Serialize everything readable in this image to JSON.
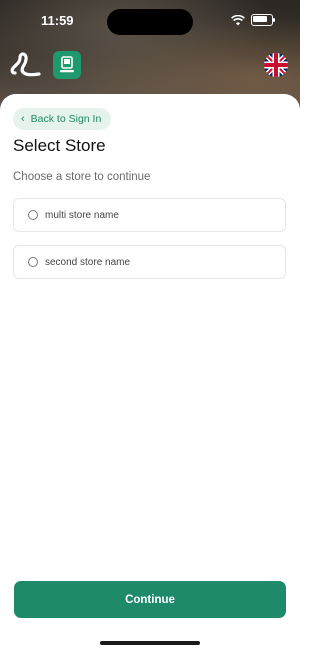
{
  "status_bar": {
    "time": "11:59",
    "icons": [
      "wifi-icon",
      "battery-icon"
    ]
  },
  "header": {
    "logo_icon": "brand-logo-icon",
    "app_icon": "kiosk-app-icon",
    "language_icon": "uk-flag-icon"
  },
  "nav": {
    "back_label": "Back to Sign In"
  },
  "page": {
    "title": "Select Store",
    "subtitle": "Choose a store to continue"
  },
  "stores": [
    {
      "label": "multi store name",
      "selected": false
    },
    {
      "label": "second store name",
      "selected": false
    }
  ],
  "actions": {
    "continue_label": "Continue"
  },
  "colors": {
    "accent": "#1e8a6a",
    "accent_light": "#e5f3ec",
    "text_primary": "#111111",
    "text_secondary": "#6a6a6a"
  }
}
